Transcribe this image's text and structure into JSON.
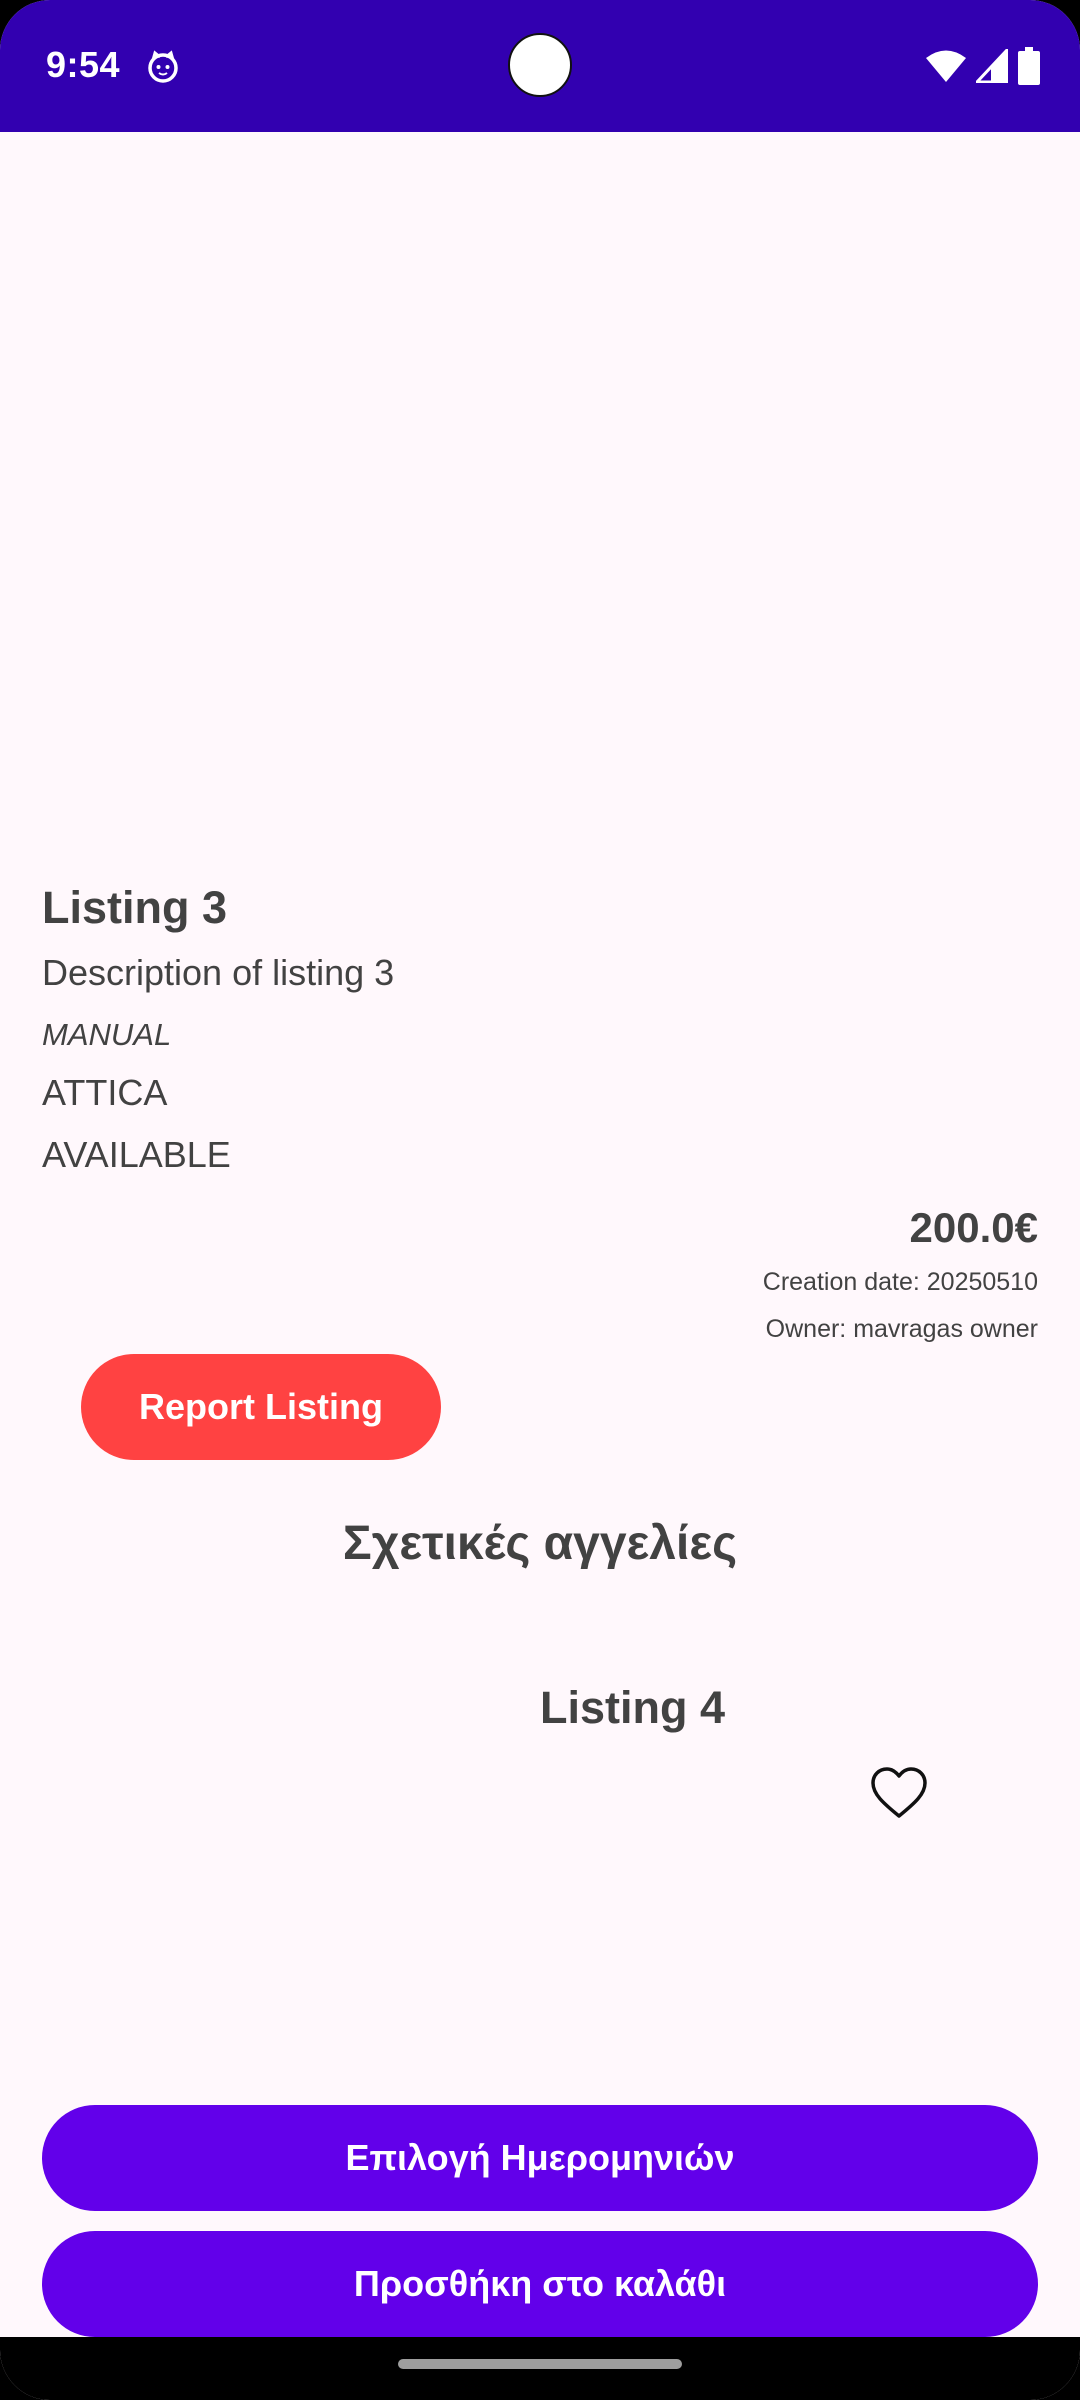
{
  "status_bar": {
    "time": "9:54",
    "icons": [
      "cat-notification-icon",
      "wifi-icon",
      "cellular-signal-icon",
      "battery-icon"
    ],
    "background_color": "#3200b0"
  },
  "listing": {
    "title": "Listing 3",
    "description": "Description of listing 3",
    "type": "MANUAL",
    "region": "ATTICA",
    "availability": "AVAILABLE",
    "price": "200.0€",
    "creation_date": "Creation date: 20250510",
    "owner": "Owner: mavragas owner"
  },
  "actions": {
    "report_label": "Report Listing",
    "report_color": "#ff4242",
    "select_dates_label": "Επιλογή Ημερομηνιών",
    "add_to_cart_label": "Προσθήκη στο καλάθι",
    "primary_color": "#6200ea"
  },
  "related": {
    "heading": "Σχετικές αγγελίες",
    "items": [
      {
        "title": "Listing 4",
        "icon": "heart-outline-icon"
      }
    ]
  }
}
